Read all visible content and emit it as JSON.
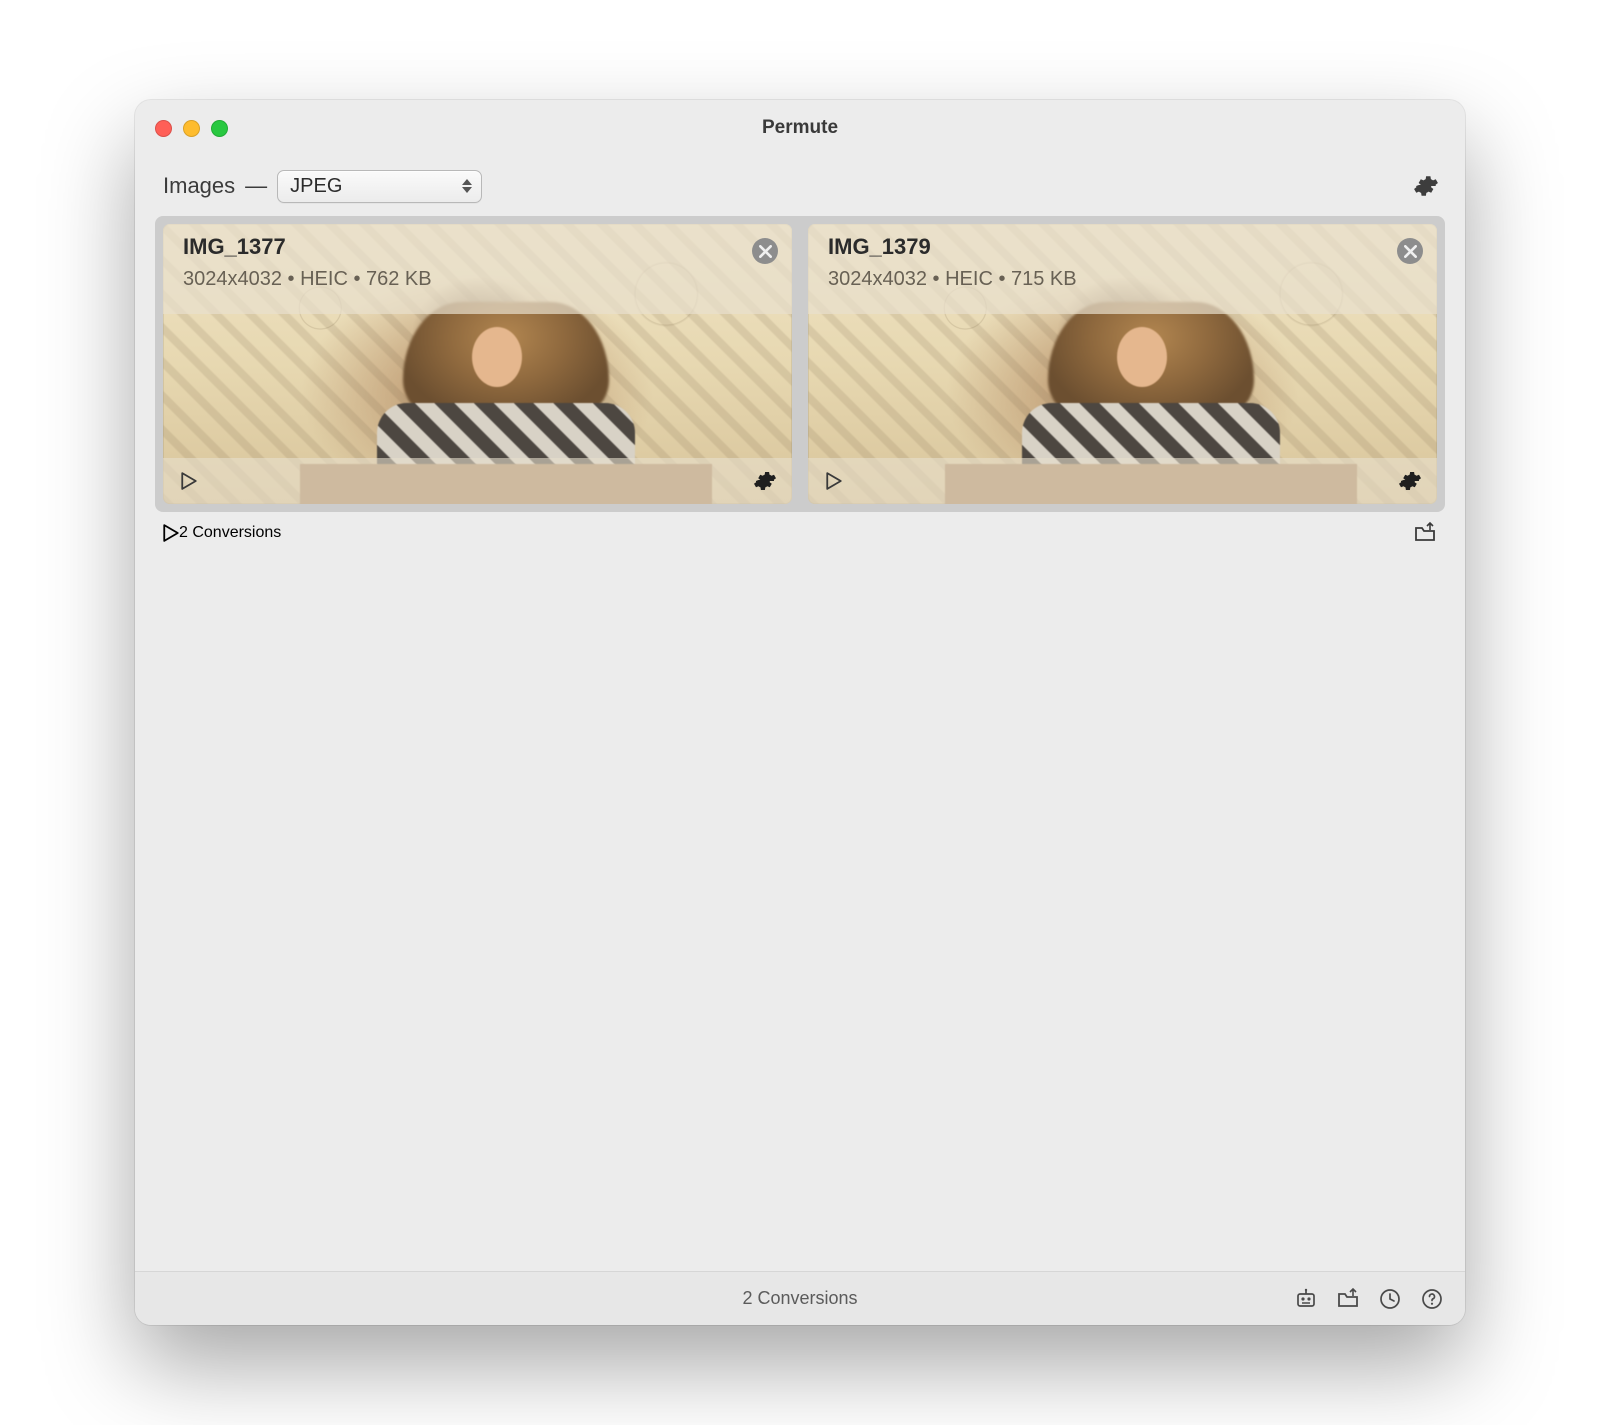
{
  "window": {
    "title": "Permute"
  },
  "toolbar": {
    "category_label": "Images",
    "format_selected": "JPEG"
  },
  "cards": [
    {
      "title": "IMG_1377",
      "meta": "3024x4032 • HEIC • 762 KB"
    },
    {
      "title": "IMG_1379",
      "meta": "3024x4032 • HEIC • 715 KB"
    }
  ],
  "group_footer": {
    "count_label": "2 Conversions"
  },
  "statusbar": {
    "count_label": "2 Conversions"
  }
}
